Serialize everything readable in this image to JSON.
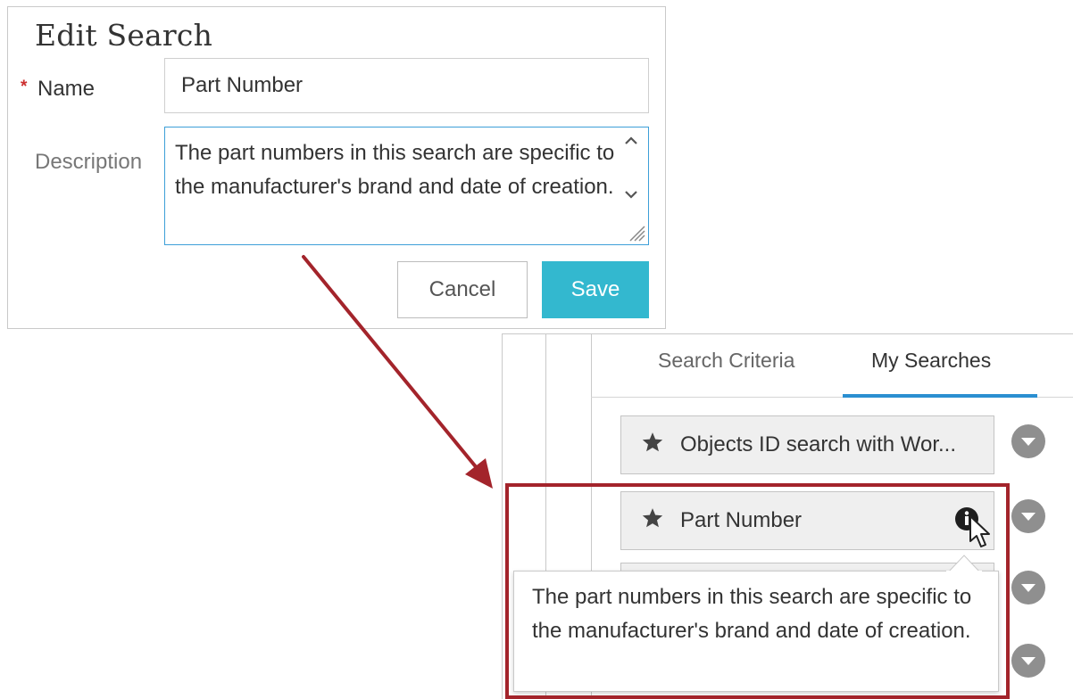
{
  "dialog": {
    "title": "Edit Search",
    "required_marker": "*",
    "name_label": "Name",
    "name_value": "Part Number",
    "description_label": "Description",
    "description_value": "The part numbers in this search are specific to the manufacturer's brand and date of creation.",
    "cancel_label": "Cancel",
    "save_label": "Save"
  },
  "panel": {
    "tabs": [
      {
        "label": "Search Criteria",
        "active": false
      },
      {
        "label": "My Searches",
        "active": true
      }
    ],
    "items": [
      {
        "label": "Objects ID search with Wor...",
        "icon": "star-icon"
      },
      {
        "label": "Part Number",
        "icon": "star-icon",
        "hover_icon": "info-icon"
      }
    ],
    "tooltip": "The part numbers in this search are specific to the manufacturer's brand and date of creation."
  },
  "colors": {
    "save_button": "#33b8cf",
    "active_tab_underline": "#2a8fd1",
    "focus_border": "#3d9fd8",
    "required_star": "#cc2e2e",
    "annotation": "#a3242b"
  }
}
